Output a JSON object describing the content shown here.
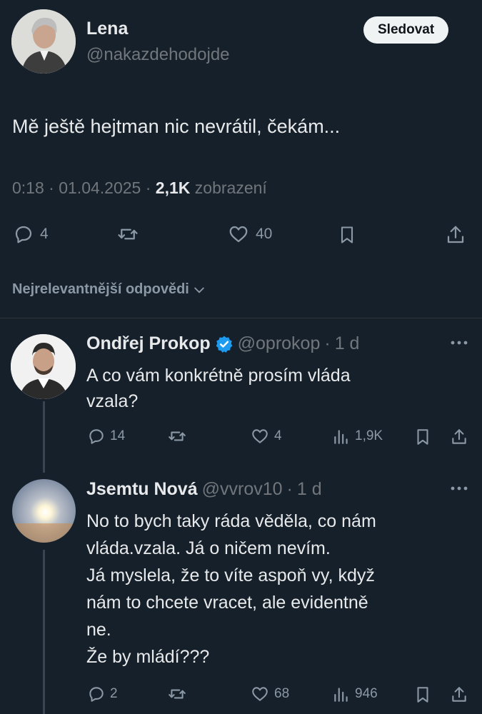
{
  "main_post": {
    "author_name": "Lena",
    "author_handle": "@nakazdehodojde",
    "follow_label": "Sledovat",
    "text": "Mě ještě hejtman nic nevrátil, čekám...",
    "time": "0:18",
    "date": "01.04.2025",
    "views_count": "2,1K",
    "views_label": "zobrazení",
    "replies": "4",
    "likes": "40"
  },
  "sort": {
    "label": "Nejrelevantnější odpovědi"
  },
  "replies": [
    {
      "name": "Ondřej Prokop",
      "verified": true,
      "handle": "@oprokop",
      "age": "1 d",
      "text_lines": [
        "A co vám konkrétně prosím vláda",
        "vzala?"
      ],
      "replies": "14",
      "likes": "4",
      "views": "1,9K"
    },
    {
      "name": "Jsemtu Nová",
      "handle": "@vvrov10",
      "age": "1 d",
      "text_lines": [
        "No to bych taky ráda věděla, co nám",
        "vláda.vzala. Já o ničem nevím.",
        "Já myslela, že to víte aspoň vy, když",
        "nám to chcete vracet, ale evidentně",
        "ne.",
        "Že by mládí???"
      ],
      "replies": "2",
      "likes": "68",
      "views": "946"
    }
  ],
  "colors": {
    "background": "#16202b",
    "text": "#e7e9ea",
    "muted": "#71767b",
    "verified": "#1d9bf0"
  }
}
